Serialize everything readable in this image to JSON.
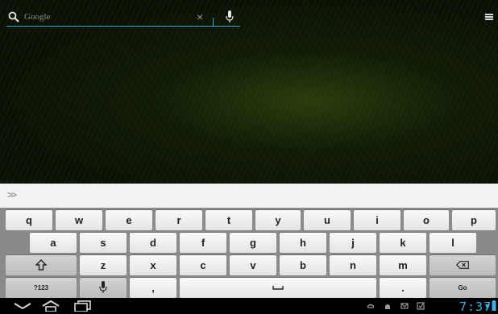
{
  "search": {
    "placeholder": "Google"
  },
  "keyboard": {
    "row1": [
      "q",
      "w",
      "e",
      "r",
      "t",
      "y",
      "u",
      "i",
      "o",
      "p"
    ],
    "row2": [
      "a",
      "s",
      "d",
      "f",
      "g",
      "h",
      "j",
      "k",
      "l"
    ],
    "row3": [
      "z",
      "x",
      "c",
      "v",
      "b",
      "n",
      "m"
    ],
    "row4": {
      "symbols": "?123",
      "comma": ",",
      "period": ".",
      "go": "Go"
    }
  },
  "status": {
    "time": "7:37"
  },
  "colors": {
    "accent": "#39a8d6",
    "clock": "#44aee2"
  }
}
